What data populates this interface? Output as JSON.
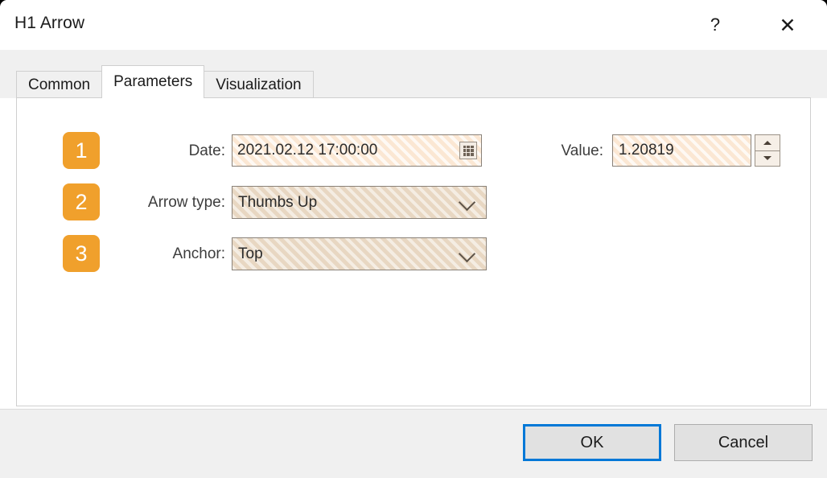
{
  "window": {
    "title": "H1 Arrow",
    "help_glyph": "?",
    "close_glyph": "✕"
  },
  "tabs": [
    {
      "label": "Common",
      "active": false
    },
    {
      "label": "Parameters",
      "active": true
    },
    {
      "label": "Visualization",
      "active": false
    }
  ],
  "badges": {
    "one": "1",
    "two": "2",
    "three": "3"
  },
  "fields": {
    "date": {
      "label": "Date:",
      "value": "2021.02.12 17:00:00",
      "icon": "calendar-icon"
    },
    "value": {
      "label": "Value:",
      "value": "1.20819",
      "spinner_up": "spin-up-icon",
      "spinner_down": "spin-down-icon"
    },
    "arrow_type": {
      "label": "Arrow type:",
      "value": "Thumbs Up"
    },
    "anchor": {
      "label": "Anchor:",
      "value": "Top"
    }
  },
  "footer": {
    "ok_label": "OK",
    "cancel_label": "Cancel"
  },
  "colors": {
    "accent_badge": "#f0a02c",
    "highlight_band": "#fbe7d3",
    "combo_fill": "#e8d7c2",
    "focus_blue": "#0078d7",
    "chrome_gray": "#f0f0f0"
  }
}
